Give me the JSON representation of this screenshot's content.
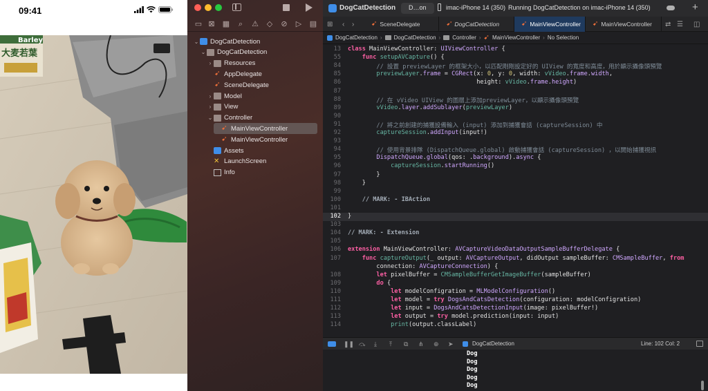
{
  "phone": {
    "time": "09:41",
    "icons": [
      "signal-icon",
      "wifi-icon",
      "battery-icon"
    ],
    "product_text": "Barley",
    "product_text_2": "大麦若葉"
  },
  "navigator": {
    "toolbar_icons": [
      "sidebar-toggle-icon",
      "stop-icon",
      "run-icon"
    ],
    "tool_icons": [
      "folder-icon",
      "source-control-icon",
      "symbol-icon",
      "find-icon",
      "issue-icon",
      "test-icon",
      "debug-icon",
      "breakpoint-icon",
      "report-icon"
    ],
    "tree": [
      {
        "label": "DogCatDetection",
        "kind": "project",
        "level": 0,
        "expanded": true
      },
      {
        "label": "DogCatDetection",
        "kind": "folder",
        "level": 1,
        "expanded": true
      },
      {
        "label": "Resources",
        "kind": "folder",
        "level": 2,
        "expanded": false
      },
      {
        "label": "AppDelegate",
        "kind": "swift",
        "level": 2
      },
      {
        "label": "SceneDelegate",
        "kind": "swift",
        "level": 2
      },
      {
        "label": "Model",
        "kind": "folder",
        "level": 2,
        "expanded": false
      },
      {
        "label": "View",
        "kind": "folder",
        "level": 2,
        "expanded": false
      },
      {
        "label": "Controller",
        "kind": "folder",
        "level": 2,
        "expanded": true
      },
      {
        "label": "MainViewController",
        "kind": "swift",
        "level": 3,
        "selected": true
      },
      {
        "label": "MainViewController",
        "kind": "swift",
        "level": 3
      },
      {
        "label": "Assets",
        "kind": "assets",
        "level": 2
      },
      {
        "label": "LaunchScreen",
        "kind": "storyboard",
        "level": 2
      },
      {
        "label": "Info",
        "kind": "plist",
        "level": 2
      }
    ]
  },
  "titlebar": {
    "project": "DogCatDetection",
    "scheme": "D…on",
    "device": "imac-iPhone 14 (350)",
    "status": "Running DogCatDetection on imac-iPhone 14 (350)"
  },
  "tabs": [
    {
      "label": "SceneDelegate",
      "active": false,
      "italic": false
    },
    {
      "label": "DogCatDetection",
      "active": false,
      "italic": true
    },
    {
      "label": "MainViewController",
      "active": true,
      "italic": false
    },
    {
      "label": "MainViewController",
      "active": false,
      "italic": false
    }
  ],
  "jumpbar": [
    "DogCatDetection",
    "DogCatDetection",
    "Controller",
    "MainViewController",
    "No Selection"
  ],
  "code": [
    {
      "n": "13",
      "t": "class MainViewController: UIViewController {",
      "sticky": true
    },
    {
      "n": "55",
      "t": "    func setupAVCapture() {",
      "sticky": true
    },
    {
      "n": "84",
      "t": "        // 設置 previewLayer 的框架大小，以匹配剛剛設定好的 UIView 的寬度和高度，用於顯示攝像頭預覽"
    },
    {
      "n": "85",
      "t": "        previewLayer.frame = CGRect(x: 0, y: 0, width: vVideo.frame.width,"
    },
    {
      "n": "86",
      "t": "                                    height: vVideo.frame.height)"
    },
    {
      "n": "87",
      "t": ""
    },
    {
      "n": "88",
      "t": "        // 在 vVideo UIView 的圖層上添加previewLayer，以顯示攝像頭預覽"
    },
    {
      "n": "89",
      "t": "        vVideo.layer.addSublayer(previewLayer)"
    },
    {
      "n": "90",
      "t": ""
    },
    {
      "n": "91",
      "t": "        // 將之前創建的捕獲設備輸入 (input) 添加到捕獲會話 (captureSession) 中"
    },
    {
      "n": "92",
      "t": "        captureSession.addInput(input!)"
    },
    {
      "n": "93",
      "t": ""
    },
    {
      "n": "94",
      "t": "        // 使用背景排隊 (DispatchQueue.global) 啟動捕獲會話 (captureSession) ，以開始捕獲視訊"
    },
    {
      "n": "95",
      "t": "        DispatchQueue.global(qos: .background).async {"
    },
    {
      "n": "96",
      "t": "            captureSession.startRunning()"
    },
    {
      "n": "97",
      "t": "        }"
    },
    {
      "n": "98",
      "t": "    }"
    },
    {
      "n": "99",
      "t": ""
    },
    {
      "n": "100",
      "t": "    // MARK: - IBAction"
    },
    {
      "n": "101",
      "t": ""
    },
    {
      "n": "102",
      "t": "}",
      "current": true
    },
    {
      "n": "103",
      "t": ""
    },
    {
      "n": "104",
      "t": "// MARK: - Extension"
    },
    {
      "n": "105",
      "t": ""
    },
    {
      "n": "106",
      "t": "extension MainViewController: AVCaptureVideoDataOutputSampleBufferDelegate {"
    },
    {
      "n": "107",
      "t": "    func captureOutput(_ output: AVCaptureOutput, didOutput sampleBuffer: CMSampleBuffer, from"
    },
    {
      "n": "",
      "t": "        connection: AVCaptureConnection) {"
    },
    {
      "n": "108",
      "t": "        let pixelBuffer = CMSampleBufferGetImageBuffer(sampleBuffer)"
    },
    {
      "n": "109",
      "t": "        do {"
    },
    {
      "n": "110",
      "t": "            let modelConfigration = MLModelConfiguration()"
    },
    {
      "n": "111",
      "t": "            let model = try DogsAndCatsDetection(configuration: modelConfigration)"
    },
    {
      "n": "112",
      "t": "            let input = DogsAndCatsDetectionInput(image: pixelBuffer!)"
    },
    {
      "n": "113",
      "t": "            let output = try model.prediction(input: input)"
    },
    {
      "n": "114",
      "t": "            print(output.classLabel)"
    }
  ],
  "debugbar": {
    "target": "DogCatDetection",
    "position": "Line: 102  Col: 2"
  },
  "console": [
    "Dog",
    "Dog",
    "Dog",
    "Dog",
    "Dog"
  ]
}
